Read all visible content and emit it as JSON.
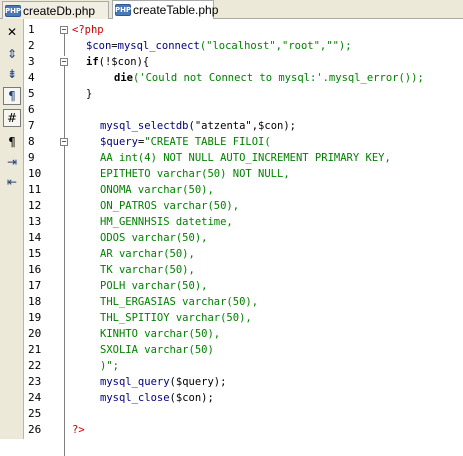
{
  "tabs": [
    {
      "label": "createDb.php",
      "icon": "php-file-icon",
      "active": false
    },
    {
      "label": "createTable.php",
      "icon": "php-file-icon",
      "active": true
    }
  ],
  "tab_icon_text": "PHP",
  "toolstrip": {
    "items": [
      {
        "name": "close-icon",
        "glyph": "✕"
      },
      {
        "name": "expand-all-icon",
        "glyph": "⇕"
      },
      {
        "name": "collapse-all-icon",
        "glyph": "⇟"
      },
      {
        "name": "word-wrap-icon",
        "glyph": "¶"
      },
      {
        "name": "line-numbers-icon",
        "glyph": "#"
      },
      {
        "name": "show-whitespace-icon",
        "glyph": "¶"
      },
      {
        "name": "indent-icon",
        "glyph": "⇥"
      },
      {
        "name": "outdent-icon",
        "glyph": "⇤"
      }
    ]
  },
  "line_numbers": [
    "1",
    "2",
    "3",
    "4",
    "5",
    "6",
    "7",
    "8",
    "9",
    "10",
    "11",
    "12",
    "13",
    "14",
    "15",
    "16",
    "17",
    "18",
    "19",
    "20",
    "21",
    "22",
    "23",
    "24",
    "25",
    "26"
  ],
  "code": {
    "l1": {
      "open_tag": "<?php"
    },
    "l2": {
      "var": "$con",
      "eq": "=",
      "fn": "mysql_connect",
      "args": "(\"localhost\",\"root\",\"\");"
    },
    "l3": {
      "kw": "if",
      "rest": "(!$con){"
    },
    "l4": {
      "kw": "die",
      "rest": "('Could not Connect to mysql:'.mysql_error());"
    },
    "l5": {
      "text": "}"
    },
    "l7": {
      "fn": "mysql_selectdb",
      "args": "(\"atzenta\",$con);"
    },
    "l8": {
      "var": "$query",
      "eq": "=",
      "str": "\"CREATE TABLE FILOI("
    },
    "l9": {
      "str": "AA int(4) NOT NULL AUTO_INCREMENT PRIMARY KEY,"
    },
    "l10": {
      "str": "EPITHETO varchar(50) NOT NULL,"
    },
    "l11": {
      "str": "ONOMA varchar(50),"
    },
    "l12": {
      "str": "ON_PATROS varchar(50),"
    },
    "l13": {
      "str": "HM_GENNHSIS datetime,"
    },
    "l14": {
      "str": "ODOS varchar(50),"
    },
    "l15": {
      "str": "AR varchar(50),"
    },
    "l16": {
      "str": "TK varchar(50),"
    },
    "l17": {
      "str": "POLH varchar(50),"
    },
    "l18": {
      "str": "THL_ERGASIAS varchar(50),"
    },
    "l19": {
      "str": "THL_SPITIOY varchar(50),"
    },
    "l20": {
      "str": "KINHTO varchar(50),"
    },
    "l21": {
      "str": "SXOLIA varchar(50)"
    },
    "l22": {
      "str": ")\";"
    },
    "l23": {
      "fn": "mysql_query",
      "args": "($query);"
    },
    "l24": {
      "fn": "mysql_close",
      "args": "($con);"
    },
    "l26": {
      "close_tag": "?>"
    }
  }
}
